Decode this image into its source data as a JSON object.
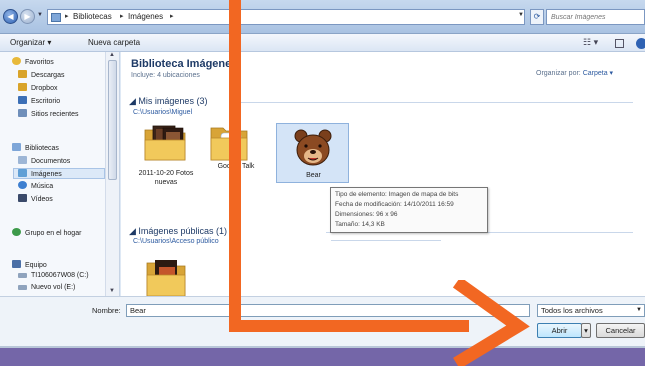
{
  "address_bar": {
    "breadcrumbs": [
      "Bibliotecas",
      "Imágenes"
    ],
    "search_placeholder": "Buscar Imágenes"
  },
  "toolbar": {
    "organize": "Organizar",
    "new_folder": "Nueva carpeta"
  },
  "sidebar": {
    "favorites": [
      {
        "label": "Favoritos",
        "icon": "star-icon",
        "color": "#e8b93a"
      },
      {
        "label": "Descargas",
        "icon": "download-folder-icon",
        "color": "#d9a42a"
      },
      {
        "label": "Dropbox",
        "icon": "dropbox-folder-icon",
        "color": "#d9a42a"
      },
      {
        "label": "Escritorio",
        "icon": "desktop-icon",
        "color": "#3b6fb6"
      },
      {
        "label": "Sitios recientes",
        "icon": "recent-places-icon",
        "color": "#6f8fba"
      }
    ],
    "libraries": [
      {
        "label": "Bibliotecas",
        "icon": "library-icon",
        "color": "#7ea6d8"
      },
      {
        "label": "Documentos",
        "icon": "documents-icon",
        "color": "#9db6d6"
      },
      {
        "label": "Imágenes",
        "icon": "pictures-icon",
        "color": "#5f9fd6",
        "selected": true
      },
      {
        "label": "Música",
        "icon": "music-icon",
        "color": "#3d7fd0"
      },
      {
        "label": "Vídeos",
        "icon": "videos-icon",
        "color": "#3a4a6a"
      }
    ],
    "homegroup": {
      "label": "Grupo en el hogar",
      "icon": "homegroup-icon",
      "color": "#3d9a4a"
    },
    "computer": [
      {
        "label": "Equipo",
        "icon": "computer-icon",
        "color": "#4a6fa6"
      },
      {
        "label": "TI106067W08 (C:)",
        "icon": "drive-icon",
        "color": "#8fa3bd"
      },
      {
        "label": "Nuevo vol (E:)",
        "icon": "drive-icon",
        "color": "#8fa3bd"
      }
    ]
  },
  "content": {
    "title": "Biblioteca Imágenes",
    "subtitle": "Incluye: 4 ubicaciones",
    "arrange_label": "Organizar por:",
    "arrange_value": "Carpeta",
    "groups": [
      {
        "name": "Mis imágenes (3)",
        "path": "C:\\Usuarios\\Miguel",
        "items": [
          {
            "label": "2011-10-20 Fotos nuevas",
            "icon": "photo-folder-icon"
          },
          {
            "label": "Google Talk",
            "icon": "folder-icon"
          },
          {
            "label": "Bear",
            "icon": "bear-image-icon",
            "selected": true
          }
        ]
      },
      {
        "name": "Imágenes públicas (1)",
        "path": "C:\\Usuarios\\Acceso público",
        "items": [
          {
            "label": "",
            "icon": "photo-folder-icon"
          }
        ]
      }
    ]
  },
  "tooltip": {
    "lines": [
      "Tipo de elemento: Imagen de mapa de bits",
      "Fecha de modificación: 14/10/2011 16:59",
      "Dimensiones: 96 x 96",
      "Tamaño: 14,3 KB"
    ]
  },
  "footer": {
    "filename_label": "Nombre:",
    "filename_value": "Bear",
    "filter_value": "Todos los archivos",
    "open_label": "Abrir",
    "cancel_label": "Cancelar"
  },
  "colors": {
    "annotation_orange": "#f26722",
    "background_purple": "#7466a8"
  }
}
